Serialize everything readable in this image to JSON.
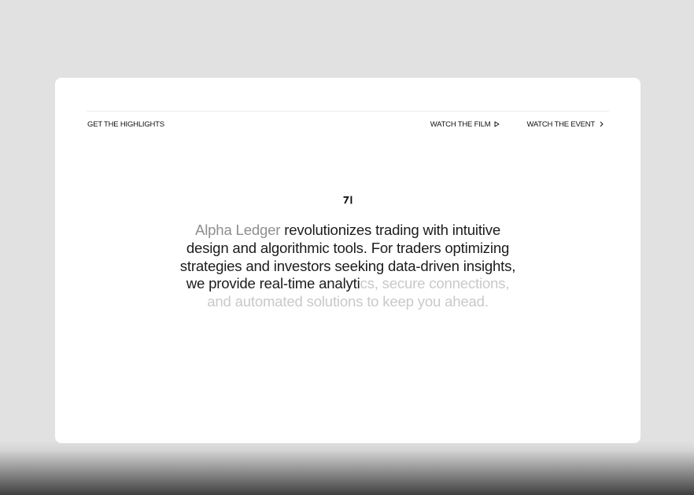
{
  "nav": {
    "highlights_label": "GET THE HIGHLIGHTS",
    "film_label": "WATCH THE FILM",
    "event_label": "WATCH THE EVENT",
    "film_icon": "play-outline-icon",
    "event_icon": "chevron-right-icon"
  },
  "brand": {
    "logo_icon": "alpha-ledger-logo-icon"
  },
  "hero": {
    "segments": [
      "Alpha Ledger",
      " revolutionizes trading with intuitive design and algorithmic tools. For traders optimizing strategies and investors seeking data-driven insights, we provide real-time analyti",
      "cs, secure connections, and automated solutions to keep you ahead."
    ]
  },
  "colors": {
    "background": "#e1e1e1",
    "card": "#ffffff",
    "text": "#1c1c1c",
    "text_muted": "#8f8f8f",
    "text_faded": "#c9c9c9"
  }
}
